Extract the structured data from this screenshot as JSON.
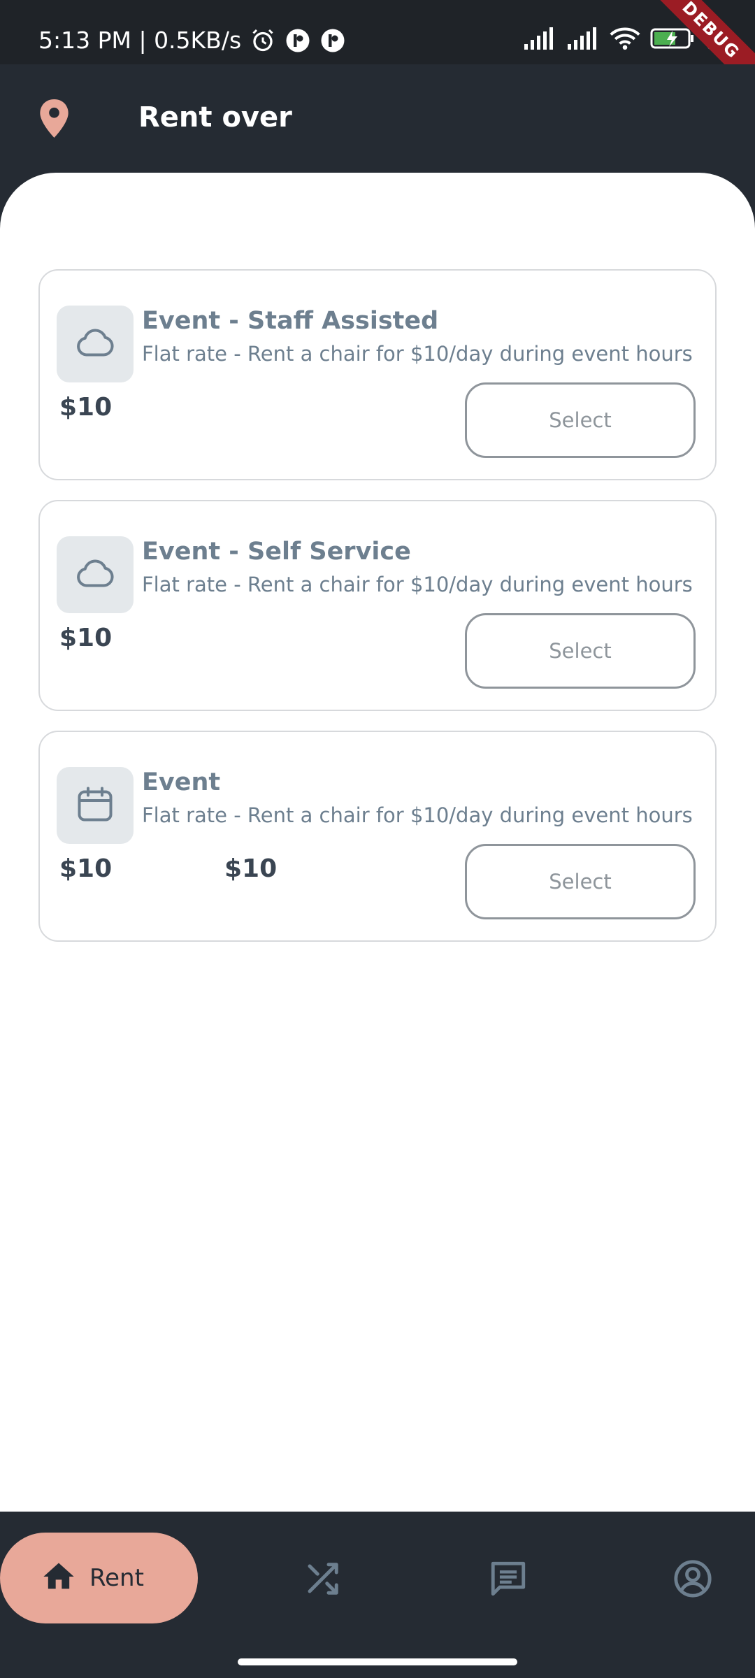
{
  "status_bar": {
    "time_speed": "5:13 PM | 0.5KB/s",
    "battery": "66",
    "debug_label": "DEBUG",
    "icons": [
      "alarm-icon",
      "app-notification-icon",
      "app-notification-icon",
      "signal-icon",
      "signal-icon",
      "wifi-icon",
      "battery-charging-icon"
    ]
  },
  "app_bar": {
    "title": "Rent over",
    "icon": "location-pin-icon"
  },
  "cards": [
    {
      "icon": "cloud-icon",
      "title": "Event - Staff Assisted",
      "description": "Flat rate - Rent a chair for $10/day during event hours",
      "price": "$10",
      "price_secondary": "",
      "button_label": "Select"
    },
    {
      "icon": "cloud-icon",
      "title": "Event - Self Service",
      "description": "Flat rate - Rent a chair for $10/day during event hours",
      "price": "$10",
      "price_secondary": "",
      "button_label": "Select"
    },
    {
      "icon": "calendar-icon",
      "title": "Event",
      "description": "Flat rate - Rent a chair for $10/day during event hours",
      "price": "$10",
      "price_secondary": "$10",
      "button_label": "Select"
    }
  ],
  "bottom_nav": {
    "active_label": "Rent",
    "items": [
      "home-icon",
      "shuffle-icon",
      "chat-icon",
      "account-icon"
    ]
  },
  "colors": {
    "accent": "#e8a899",
    "dark_bg": "#252b33",
    "text_muted": "#6d7f8f"
  }
}
